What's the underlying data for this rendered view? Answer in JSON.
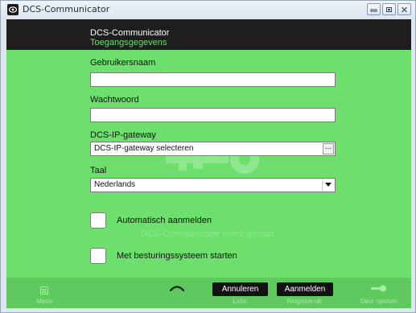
{
  "window": {
    "title": "DCS-Communicator"
  },
  "header": {
    "app_name": "DCS-Communicator",
    "subtitle": "Toegangsgegevens"
  },
  "form": {
    "username": {
      "label": "Gebruikersnaam",
      "value": ""
    },
    "password": {
      "label": "Wachtwoord",
      "value": ""
    },
    "gateway": {
      "label": "DCS-IP-gateway",
      "value": "DCS-IP-gateway selecteren",
      "browse_label": "..."
    },
    "language": {
      "label": "Taal",
      "value": "Nederlands"
    },
    "auto_login": {
      "label": "Automatisch aanmelden",
      "checked": false
    },
    "start_with_os": {
      "label": "Met besturingssysteem starten",
      "checked": false
    }
  },
  "status_text": "DCS-Communicator wordt gestart...",
  "footer": {
    "menu_label": "Menu",
    "light_label": "Licht",
    "ringtone_label": "Ringtone uit",
    "door_label": "Deur openen"
  },
  "buttons": {
    "cancel": "Annuleren",
    "login": "Aanmelden"
  },
  "colors": {
    "background": "#6ddf6d",
    "header": "#1e1e1e",
    "accent": "#6ddf6d"
  },
  "icons": [
    "app-icon",
    "minimize-icon",
    "maximize-icon",
    "close-icon",
    "key-icon",
    "menu-icon",
    "phone-icon",
    "door-open-icon",
    "chevron-down-icon"
  ]
}
